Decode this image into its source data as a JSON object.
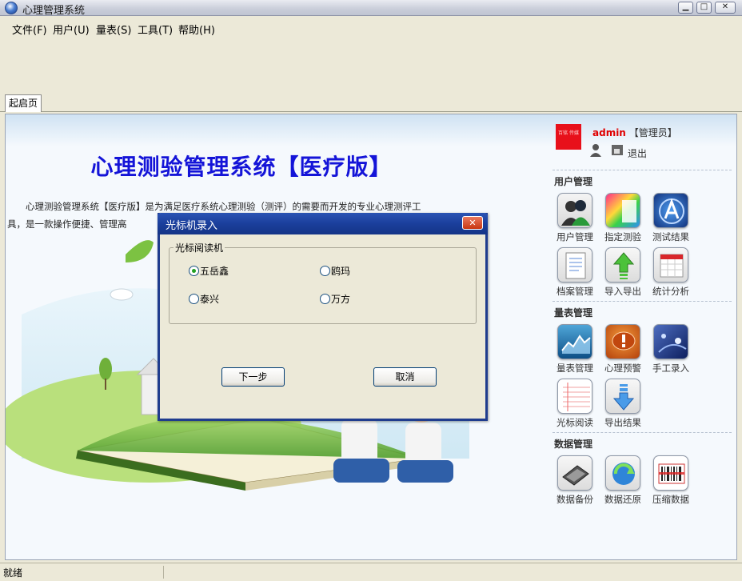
{
  "window": {
    "title": "心理管理系统",
    "btn_min": "0",
    "btn_max": "1",
    "btn_close": "r"
  },
  "menu": [
    {
      "label": "文件(F)"
    },
    {
      "label": "用户(U)"
    },
    {
      "label": "量表(S)"
    },
    {
      "label": "工具(T)"
    },
    {
      "label": "帮助(H)"
    }
  ],
  "tabs": [
    {
      "label": "起启页"
    }
  ],
  "main": {
    "title": "心理测验管理系统【医疗版】",
    "intro": "心理测验管理系统【医疗版】是为满足医疗系统心理测验（测评）的需要而开发的专业心理测评工具，是一款操作便捷、管理高"
  },
  "user": {
    "avatar_text": "百铭 传媒",
    "name": "admin",
    "role": "【管理员】",
    "logout": "退出"
  },
  "sections": [
    {
      "title": "用户管理",
      "items": [
        {
          "label": "用户管理",
          "icon": "users-icon"
        },
        {
          "label": "指定测验",
          "icon": "assign-test-icon"
        },
        {
          "label": "测试结果",
          "icon": "test-results-icon"
        },
        {
          "label": "档案管理",
          "icon": "archive-icon"
        },
        {
          "label": "导入导出",
          "icon": "import-export-icon"
        },
        {
          "label": "统计分析",
          "icon": "statistics-icon"
        }
      ]
    },
    {
      "title": "量表管理",
      "items": [
        {
          "label": "量表管理",
          "icon": "scale-chart-icon"
        },
        {
          "label": "心理预警",
          "icon": "warning-bubble-icon"
        },
        {
          "label": "手工录入",
          "icon": "manual-entry-icon"
        },
        {
          "label": "光标阅读",
          "icon": "notebook-icon"
        },
        {
          "label": "导出结果",
          "icon": "export-arrow-icon"
        }
      ]
    },
    {
      "title": "数据管理",
      "items": [
        {
          "label": "数据备份",
          "icon": "backup-disk-icon"
        },
        {
          "label": "数据还原",
          "icon": "restore-icon"
        },
        {
          "label": "压缩数据",
          "icon": "barcode-icon"
        }
      ]
    }
  ],
  "status": {
    "text": "就绪"
  },
  "dialog": {
    "title": "光标机录入",
    "close": "✕",
    "group_label": "光标阅读机",
    "options": [
      {
        "label": "五岳鑫",
        "selected": true
      },
      {
        "label": "鸥玛",
        "selected": false
      },
      {
        "label": "泰兴",
        "selected": false
      },
      {
        "label": "万方",
        "selected": false
      }
    ],
    "next_button": "下一步",
    "cancel_button": "取消"
  }
}
